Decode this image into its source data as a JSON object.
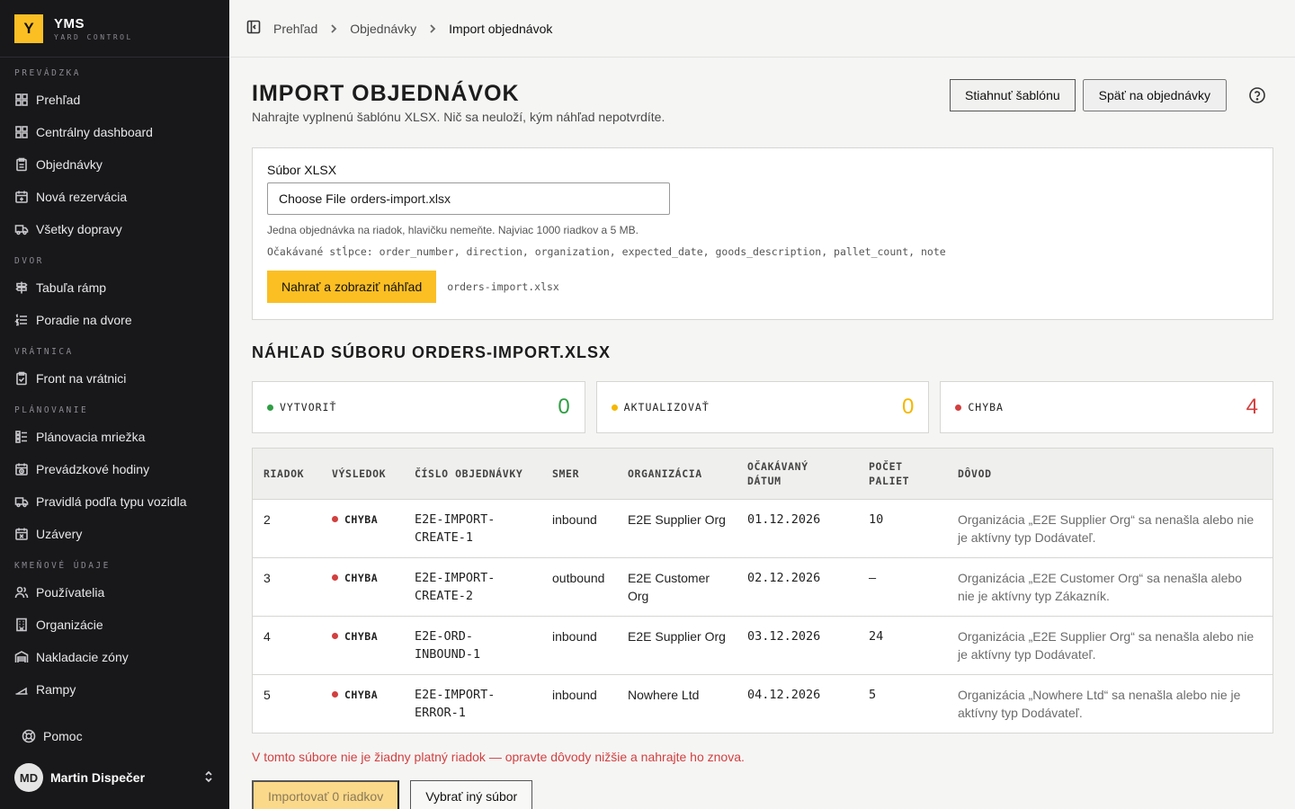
{
  "brand": {
    "logo_letter": "Y",
    "name": "YMS",
    "subtitle": "YARD CONTROL"
  },
  "sidebar": {
    "sections": [
      {
        "title": "PREVÁDZKA",
        "items": [
          {
            "label": "Prehľad",
            "icon": "grid-icon"
          },
          {
            "label": "Centrálny dashboard",
            "icon": "grid-icon"
          },
          {
            "label": "Objednávky",
            "icon": "clipboard-icon"
          },
          {
            "label": "Nová rezervácia",
            "icon": "calendar-plus-icon"
          },
          {
            "label": "Všetky dopravy",
            "icon": "truck-icon"
          }
        ]
      },
      {
        "title": "DVOR",
        "items": [
          {
            "label": "Tabuľa rámp",
            "icon": "signpost-icon"
          },
          {
            "label": "Poradie na dvore",
            "icon": "list-ordered-icon"
          }
        ]
      },
      {
        "title": "VRÁTNICA",
        "items": [
          {
            "label": "Front na vrátnici",
            "icon": "clipboard-check-icon"
          }
        ]
      },
      {
        "title": "PLÁNOVANIE",
        "items": [
          {
            "label": "Plánovacia mriežka",
            "icon": "grid-rows-icon"
          },
          {
            "label": "Prevádzkové hodiny",
            "icon": "calendar-clock-icon"
          },
          {
            "label": "Pravidlá podľa typu vozidla",
            "icon": "truck-icon"
          },
          {
            "label": "Uzávery",
            "icon": "calendar-x-icon"
          }
        ]
      },
      {
        "title": "KMEŇOVÉ ÚDAJE",
        "items": [
          {
            "label": "Používatelia",
            "icon": "users-icon"
          },
          {
            "label": "Organizácie",
            "icon": "building-icon"
          },
          {
            "label": "Nakladacie zóny",
            "icon": "warehouse-icon"
          },
          {
            "label": "Rampy",
            "icon": "ramp-icon"
          }
        ]
      }
    ],
    "help_label": "Pomoc",
    "user": {
      "initials": "MD",
      "name": "Martin Dispečer"
    }
  },
  "breadcrumb": [
    "Prehľad",
    "Objednávky",
    "Import objednávok"
  ],
  "page": {
    "title": "IMPORT OBJEDNÁVOK",
    "subtitle": "Nahrajte vyplnenú šablónu XLSX. Nič sa neuloží, kým náhľad nepotvrdíte.",
    "download_template": "Stiahnuť šablónu",
    "back_to_orders": "Späť na objednávky"
  },
  "upload": {
    "label": "Súbor XLSX",
    "choose_button": "Choose File",
    "file_name": "orders-import.xlsx",
    "hint": "Jedna objednávka na riadok, hlavičku nemeňte. Najviac 1000 riadkov a 5 MB.",
    "columns": "Očakávané stĺpce: order_number, direction, organization, expected_date, goods_description, pallet_count, note",
    "submit": "Nahrať a zobraziť náhľad",
    "uploaded_file": "orders-import.xlsx"
  },
  "preview": {
    "title": "NÁHĽAD SÚBORU ORDERS-IMPORT.XLSX",
    "stats": [
      {
        "label": "VYTVORIŤ",
        "value": "0",
        "color": "#2f9e44"
      },
      {
        "label": "AKTUALIZOVAŤ",
        "value": "0",
        "color": "#f5b700"
      },
      {
        "label": "CHYBA",
        "value": "4",
        "color": "#d23f3f"
      }
    ],
    "columns": [
      "RIADOK",
      "VÝSLEDOK",
      "ČÍSLO OBJEDNÁVKY",
      "SMER",
      "ORGANIZÁCIA",
      "OČAKÁVANÝ DÁTUM",
      "POČET PALIET",
      "DÔVOD"
    ],
    "rows": [
      {
        "row": "2",
        "result": "CHYBA",
        "order": "E2E-IMPORT-CREATE-1",
        "direction": "inbound",
        "organization": "E2E Supplier Org",
        "date": "01.12.2026",
        "pallets": "10",
        "reason": "Organizácia „E2E Supplier Org“ sa nenašla alebo nie je aktívny typ Dodávateľ."
      },
      {
        "row": "3",
        "result": "CHYBA",
        "order": "E2E-IMPORT-CREATE-2",
        "direction": "outbound",
        "organization": "E2E Customer Org",
        "date": "02.12.2026",
        "pallets": "—",
        "reason": "Organizácia „E2E Customer Org“ sa nenašla alebo nie je aktívny typ Zákazník."
      },
      {
        "row": "4",
        "result": "CHYBA",
        "order": "E2E-ORD-INBOUND-1",
        "direction": "inbound",
        "organization": "E2E Supplier Org",
        "date": "03.12.2026",
        "pallets": "24",
        "reason": "Organizácia „E2E Supplier Org“ sa nenašla alebo nie je aktívny typ Dodávateľ."
      },
      {
        "row": "5",
        "result": "CHYBA",
        "order": "E2E-IMPORT-ERROR-1",
        "direction": "inbound",
        "organization": "Nowhere Ltd",
        "date": "04.12.2026",
        "pallets": "5",
        "reason": "Organizácia „Nowhere Ltd“ sa nenašla alebo nie je aktívny typ Dodávateľ."
      }
    ],
    "error_message": "V tomto súbore nie je žiadny platný riadok — opravte dôvody nižšie a nahrajte ho znova.",
    "import_button": "Importovať 0 riadkov",
    "choose_other": "Vybrať iný súbor"
  },
  "colors": {
    "accent": "#fbbf24",
    "sidebar_bg": "#18181b",
    "error": "#d23f3f",
    "success": "#2f9e44"
  }
}
